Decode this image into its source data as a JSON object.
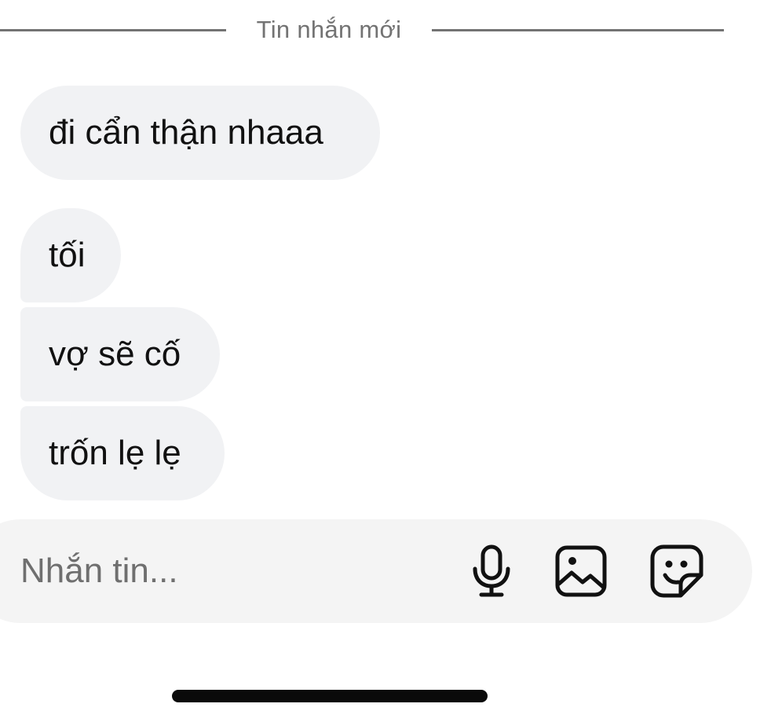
{
  "divider": {
    "label": "Tin nhắn mới"
  },
  "messages": [
    {
      "text": "đi cẩn thận nhaaa"
    },
    {
      "text": "tối"
    },
    {
      "text": "vợ sẽ cố"
    },
    {
      "text": "trốn lẹ lẹ"
    }
  ],
  "composer": {
    "placeholder": "Nhắn tin...",
    "value": "",
    "icons": [
      "microphone-icon",
      "image-icon",
      "sticker-icon"
    ]
  },
  "colors": {
    "bubble_background": "#f1f2f4",
    "composer_background": "#f4f4f4",
    "divider": "#737373",
    "text": "#111111",
    "placeholder": "#6f6f6f"
  }
}
